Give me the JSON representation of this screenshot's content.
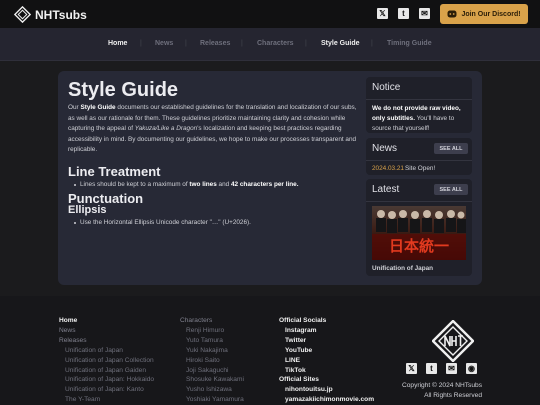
{
  "header": {
    "logo_text": "NHTsubs",
    "social_icons": [
      "x-icon",
      "tumblr-icon",
      "mail-icon"
    ],
    "discord_label": "Join Our Discord!",
    "accent": "#d9a24a"
  },
  "nav": {
    "items": [
      {
        "label": "Home"
      },
      {
        "label": "News"
      },
      {
        "label": "Releases"
      },
      {
        "label": "Characters"
      },
      {
        "label": "Style Guide"
      },
      {
        "label": "Timing Guide"
      }
    ],
    "active": "Style Guide"
  },
  "main": {
    "title": "Style Guide",
    "intro_1": "Our ",
    "intro_bold": "Style Guide",
    "intro_2": " documents our established guidelines for the translation and localization of our subs, as well as our rationale for them. These guidelines prioritize maintaining clarity and cohesion while capturing the appeal of ",
    "intro_italic": "Yakuza/Like a Dragon",
    "intro_3": "'s localization and keeping best practices regarding accessibility in mind. By documenting our guidelines, we hope to make our processes transparent and replicable.",
    "line_treatment": {
      "heading": "Line Treatment",
      "item_1": "Lines should be kept to a maximum of ",
      "item_bold_1": "two lines",
      "item_2": " and ",
      "item_bold_2": "42 characters per line."
    },
    "punctuation": {
      "heading": "Punctuation",
      "subheading": "Ellipsis",
      "item": "Use the Horizontal Ellipsis Unicode character \"…\" (U+2026)."
    }
  },
  "sidebar": {
    "notice": {
      "title": "Notice",
      "bold": "We do not provide raw video, only subtitles.",
      "text": " You'll have to source that yourself!"
    },
    "news": {
      "title": "News",
      "see_all": "SEE ALL",
      "date": "2024.03.21",
      "headline": "Site Open!"
    },
    "latest": {
      "title": "Latest",
      "see_all": "SEE ALL",
      "thumb_text": "日本統一",
      "item_title": "Unification of Japan"
    }
  },
  "footer": {
    "col1": {
      "items": [
        {
          "label": "Home",
          "type": "head"
        },
        {
          "label": "News",
          "type": "link"
        },
        {
          "label": "Releases",
          "type": "link"
        },
        {
          "label": "Unification of Japan",
          "type": "sub"
        },
        {
          "label": "Unification of Japan Collection",
          "type": "sub"
        },
        {
          "label": "Unification of Japan Gaiden",
          "type": "sub"
        },
        {
          "label": "Unification of Japan: Hokkaido",
          "type": "sub"
        },
        {
          "label": "Unification of Japan: Kanto",
          "type": "sub"
        },
        {
          "label": "The Y-Team",
          "type": "sub"
        }
      ]
    },
    "col2": {
      "items": [
        {
          "label": "Characters",
          "type": "link"
        },
        {
          "label": "Renji Himuro",
          "type": "sub"
        },
        {
          "label": "Yuto Tamura",
          "type": "sub"
        },
        {
          "label": "Yuki Nakajima",
          "type": "sub"
        },
        {
          "label": "Hiroki Saito",
          "type": "sub"
        },
        {
          "label": "Joji Sakaguchi",
          "type": "sub"
        },
        {
          "label": "Shosuke Kawakami",
          "type": "sub"
        },
        {
          "label": "Yusho Ishizawa",
          "type": "sub"
        },
        {
          "label": "Yoshiaki Yamamura",
          "type": "sub"
        }
      ]
    },
    "col3": {
      "items": [
        {
          "label": "Official Socials",
          "type": "head"
        },
        {
          "label": "Instagram",
          "type": "white"
        },
        {
          "label": "Twitter",
          "type": "white"
        },
        {
          "label": "YouTube",
          "type": "white"
        },
        {
          "label": "LINE",
          "type": "white"
        },
        {
          "label": "TikTok",
          "type": "white"
        },
        {
          "label": "Official Sites",
          "type": "head"
        },
        {
          "label": "nihontouitsu.jp",
          "type": "white"
        },
        {
          "label": "yamazakiichimonmovie.com",
          "type": "white"
        }
      ]
    },
    "social_icons": [
      "x-icon",
      "tumblr-icon",
      "mail-icon",
      "discord-icon"
    ],
    "copyright": "Copyright © 2024 NHTsubs",
    "rights": "All Rights Reserved"
  }
}
